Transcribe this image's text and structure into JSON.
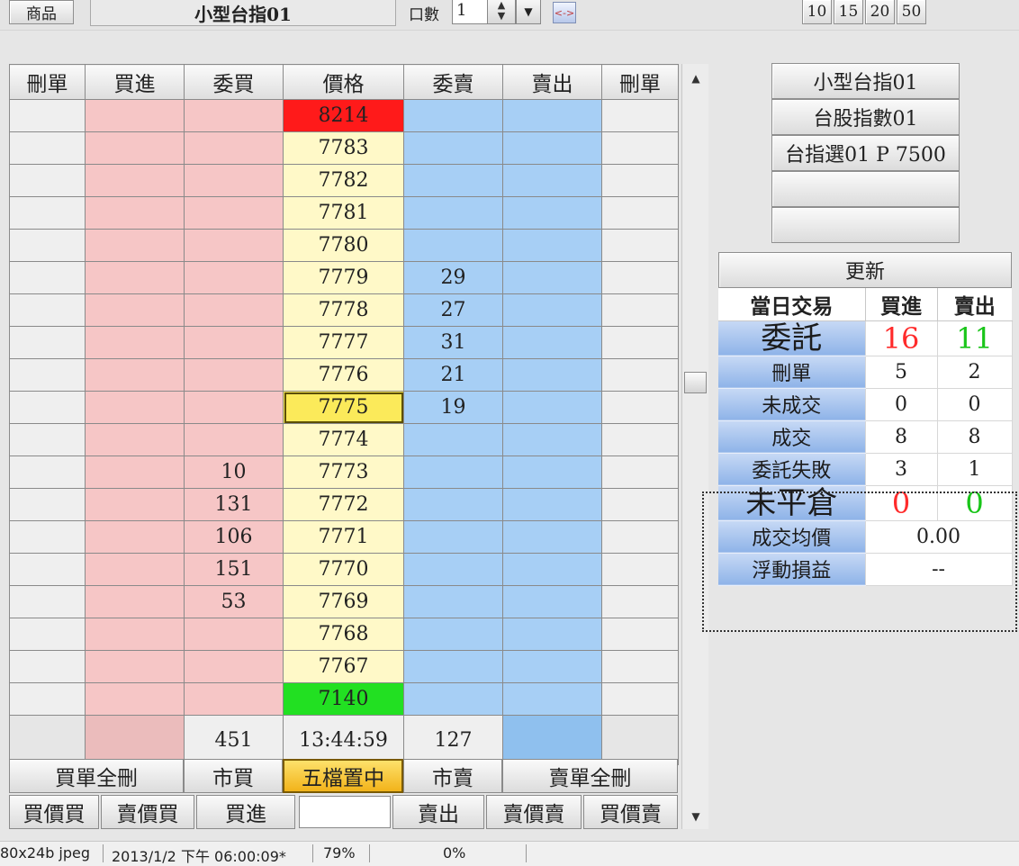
{
  "topbar": {
    "product_button": "商品",
    "product_name": "小型台指01",
    "qty_label": "口數",
    "qty_value": "1",
    "quick_sizes": [
      "10",
      "15",
      "20",
      "50"
    ]
  },
  "book": {
    "headers": [
      "刪單",
      "買進",
      "委買",
      "價格",
      "委賣",
      "賣出",
      "刪單"
    ],
    "rows": [
      {
        "price": "8214",
        "bid": "",
        "ask": "",
        "kind": "high"
      },
      {
        "price": "7783",
        "bid": "",
        "ask": "",
        "kind": ""
      },
      {
        "price": "7782",
        "bid": "",
        "ask": "",
        "kind": ""
      },
      {
        "price": "7781",
        "bid": "",
        "ask": "",
        "kind": ""
      },
      {
        "price": "7780",
        "bid": "",
        "ask": "",
        "kind": ""
      },
      {
        "price": "7779",
        "bid": "",
        "ask": "29",
        "kind": ""
      },
      {
        "price": "7778",
        "bid": "",
        "ask": "27",
        "kind": ""
      },
      {
        "price": "7777",
        "bid": "",
        "ask": "31",
        "kind": ""
      },
      {
        "price": "7776",
        "bid": "",
        "ask": "21",
        "kind": ""
      },
      {
        "price": "7775",
        "bid": "",
        "ask": "19",
        "kind": "current"
      },
      {
        "price": "7774",
        "bid": "",
        "ask": "",
        "kind": ""
      },
      {
        "price": "7773",
        "bid": "10",
        "ask": "",
        "kind": ""
      },
      {
        "price": "7772",
        "bid": "131",
        "ask": "",
        "kind": ""
      },
      {
        "price": "7771",
        "bid": "106",
        "ask": "",
        "kind": ""
      },
      {
        "price": "7770",
        "bid": "151",
        "ask": "",
        "kind": ""
      },
      {
        "price": "7769",
        "bid": "53",
        "ask": "",
        "kind": ""
      },
      {
        "price": "7768",
        "bid": "",
        "ask": "",
        "kind": ""
      },
      {
        "price": "7767",
        "bid": "",
        "ask": "",
        "kind": ""
      },
      {
        "price": "7140",
        "bid": "",
        "ask": "",
        "kind": "low"
      }
    ],
    "summary": {
      "bid_total": "451",
      "time": "13:44:59",
      "ask_total": "127"
    }
  },
  "actions_row1": {
    "delete_all_buy": "買單全刪",
    "market_buy": "市買",
    "center_five": "五檔置中",
    "market_sell": "市賣",
    "delete_all_sell": "賣單全刪"
  },
  "actions_row2": {
    "buy_at_bid": "買價買",
    "buy_at_ask": "賣價買",
    "buy": "買進",
    "sell": "賣出",
    "sell_at_ask": "賣價賣",
    "sell_at_bid": "買價賣"
  },
  "products": [
    "小型台指01",
    "台股指數01",
    "台指選01 P 7500",
    "",
    ""
  ],
  "refresh_label": "更新",
  "stats": {
    "header": {
      "label": "當日交易",
      "buy": "買進",
      "sell": "賣出"
    },
    "entrust": {
      "label": "委託",
      "buy": "16",
      "sell": "11"
    },
    "cancel": {
      "label": "刪單",
      "buy": "5",
      "sell": "2"
    },
    "unfilled": {
      "label": "未成交",
      "buy": "0",
      "sell": "0"
    },
    "filled": {
      "label": "成交",
      "buy": "8",
      "sell": "8"
    },
    "failed": {
      "label": "委託失敗",
      "buy": "3",
      "sell": "1"
    },
    "open": {
      "label": "未平倉",
      "buy": "0",
      "sell": "0"
    },
    "avg_price": {
      "label": "成交均價",
      "value": "0.00"
    },
    "float_pnl": {
      "label": "浮動損益",
      "value": "--"
    }
  },
  "statusbar": {
    "image_info": "80x24b jpeg",
    "datetime": "2013/1/2 下午 06:00:09*",
    "zoom": "79%",
    "progress": "0%"
  },
  "colors": {
    "bid_bg": "#f6c6c6",
    "ask_bg": "#a7cff5",
    "price_bg": "#fff9c8",
    "high_price": "#ff1a1a",
    "low_price": "#22e022",
    "current_price": "#fbea5a",
    "entrust_blue": "#1f2cff",
    "buy_red": "#ff2b2b",
    "sell_green": "#19c519"
  }
}
